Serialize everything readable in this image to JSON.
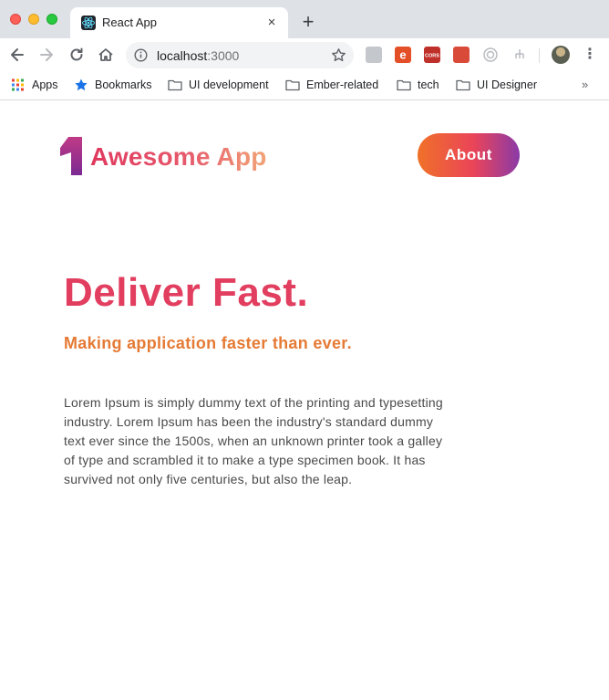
{
  "browser": {
    "tab_title": "React App",
    "tab_close": "×",
    "new_tab": "+",
    "url_host": "localhost",
    "url_port": ":3000",
    "kebab": "⋮",
    "bookmarks": [
      {
        "label": "Apps",
        "icon": "apps-grid-icon"
      },
      {
        "label": "Bookmarks",
        "icon": "star-icon"
      },
      {
        "label": "UI development",
        "icon": "folder-icon"
      },
      {
        "label": "Ember-related",
        "icon": "folder-icon"
      },
      {
        "label": "tech",
        "icon": "folder-icon"
      },
      {
        "label": "UI Designer",
        "icon": "folder-icon"
      }
    ],
    "bookmarks_more": "»"
  },
  "header": {
    "logo_text": "Awesome App",
    "about_label": "About"
  },
  "hero": {
    "title": "Deliver Fast.",
    "subtitle": "Making application faster than ever.",
    "body": "Lorem Ipsum is simply dummy text of the printing and typesetting industry. Lorem Ipsum has been the industry's standard dummy text ever since the 1500s, when an unknown printer took a galley of type and scrambled it to make a type specimen book. It has survived not only five centuries, but also the leap."
  },
  "colors": {
    "accent_red": "#e23e5f",
    "accent_orange": "#e57a34",
    "accent_purple": "#8a3aa7"
  }
}
